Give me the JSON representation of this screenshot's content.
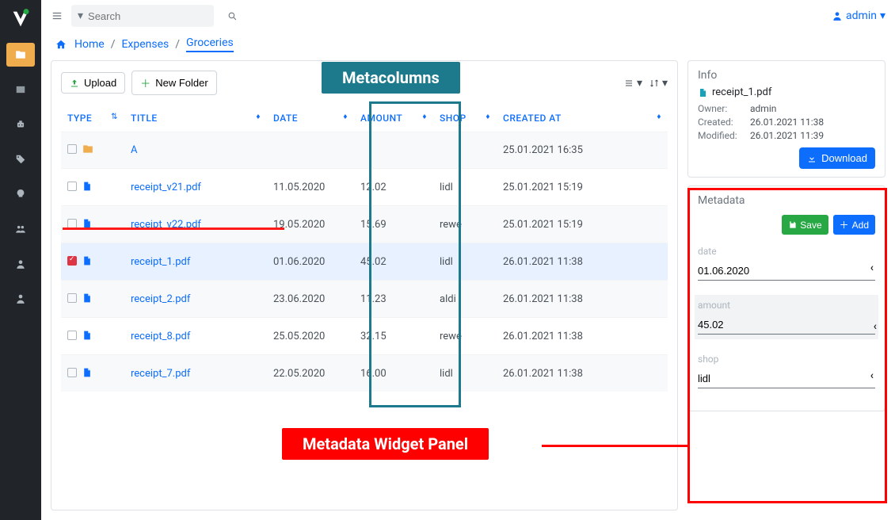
{
  "topbar": {
    "search_placeholder": "Search",
    "username": "admin"
  },
  "breadcrumb": {
    "home": "Home",
    "lvl1": "Expenses",
    "lvl2": "Groceries"
  },
  "toolbar": {
    "upload": "Upload",
    "newfolder": "New Folder"
  },
  "columns": {
    "type": "TYPE",
    "title": "TITLE",
    "date": "DATE",
    "amount": "AMOUNT",
    "shop": "SHOP",
    "created": "CREATED AT"
  },
  "rows": [
    {
      "kind": "folder",
      "checked": false,
      "title": "A",
      "date": "",
      "amount": "",
      "shop": "",
      "created": "25.01.2021 16:35"
    },
    {
      "kind": "file",
      "checked": false,
      "title": "receipt_v21.pdf",
      "date": "11.05.2020",
      "amount": "12.02",
      "shop": "lidl",
      "created": "25.01.2021 15:19"
    },
    {
      "kind": "file",
      "checked": false,
      "title": "receipt_v22.pdf",
      "date": "19.05.2020",
      "amount": "15.69",
      "shop": "rewe",
      "created": "25.01.2021 15:19"
    },
    {
      "kind": "file",
      "checked": true,
      "title": "receipt_1.pdf",
      "date": "01.06.2020",
      "amount": "45.02",
      "shop": "lidl",
      "created": "26.01.2021 11:38"
    },
    {
      "kind": "file",
      "checked": false,
      "title": "receipt_2.pdf",
      "date": "23.06.2020",
      "amount": "11.23",
      "shop": "aldi",
      "created": "26.01.2021 11:38"
    },
    {
      "kind": "file",
      "checked": false,
      "title": "receipt_8.pdf",
      "date": "25.05.2020",
      "amount": "32.15",
      "shop": "rewe",
      "created": "26.01.2021 11:38"
    },
    {
      "kind": "file",
      "checked": false,
      "title": "receipt_7.pdf",
      "date": "22.05.2020",
      "amount": "16.00",
      "shop": "lidl",
      "created": "26.01.2021 11:38"
    }
  ],
  "info": {
    "header": "Info",
    "filename": "receipt_1.pdf",
    "owner_label": "Owner:",
    "owner": "admin",
    "created_label": "Created:",
    "created": "26.01.2021 11:38",
    "modified_label": "Modified:",
    "modified": "26.01.2021 11:39",
    "download": "Download"
  },
  "metadata": {
    "header": "Metadata",
    "save": "Save",
    "add": "Add",
    "fields": {
      "date": {
        "label": "date",
        "value": "01.06.2020"
      },
      "amount": {
        "label": "amount",
        "value": "45.02"
      },
      "shop": {
        "label": "shop",
        "value": "lidl"
      }
    }
  },
  "callouts": {
    "metacolumns": "Metacolumns",
    "metadatapanel": "Metadata Widget Panel"
  }
}
